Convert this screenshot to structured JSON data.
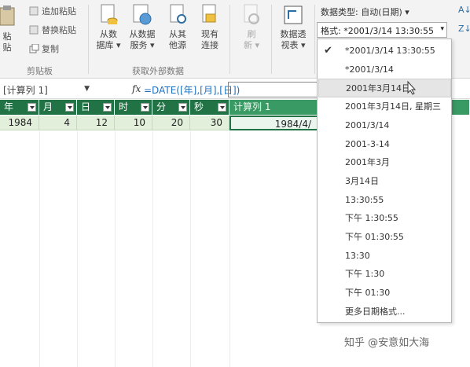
{
  "ribbon": {
    "paste_label": "粘贴",
    "paste_label_short": "粘",
    "append_paste": "追加粘贴",
    "replace_paste": "替换粘贴",
    "copy": "复制",
    "clipboard_group": "剪贴板",
    "from_database": "从数\n据库 ▾",
    "from_data_service": "从数据\n服务 ▾",
    "from_other_sources": "从其\n他源",
    "existing_connections": "现有\n连接",
    "external_group": "获取外部数据",
    "refresh": "刷\n新 ▾",
    "pivot_table": "数据透\n视表 ▾"
  },
  "datatype": {
    "label": "数据类型: 自动(日期) ▾",
    "format_value": "格式: *2001/3/14 13:30:55"
  },
  "formula_bar": {
    "name_box": "[计算列 1]",
    "fx": "fx",
    "formula": "=DATE([年],[月],[日])"
  },
  "table": {
    "headers": [
      "年",
      "月",
      "日",
      "时",
      "分",
      "秒",
      "计算列 1"
    ],
    "row": [
      "1984",
      "4",
      "12",
      "10",
      "20",
      "30",
      "1984/4/"
    ]
  },
  "menu": {
    "items": [
      "*2001/3/14 13:30:55",
      "*2001/3/14",
      "2001年3月14日",
      "2001年3月14日, 星期三",
      "2001/3/14",
      "2001-3-14",
      "2001年3月",
      "3月14日",
      "13:30:55",
      "下午 1:30:55",
      "下午 01:30:55",
      "13:30",
      "下午 1:30",
      "下午 01:30",
      "更多日期格式..."
    ],
    "checked_index": 0,
    "hover_index": 2
  },
  "watermark": "知乎 @安意如大海",
  "colors": {
    "accent": "#217346",
    "header_calc": "#3a9a63",
    "row_bg": "#e2efda"
  }
}
